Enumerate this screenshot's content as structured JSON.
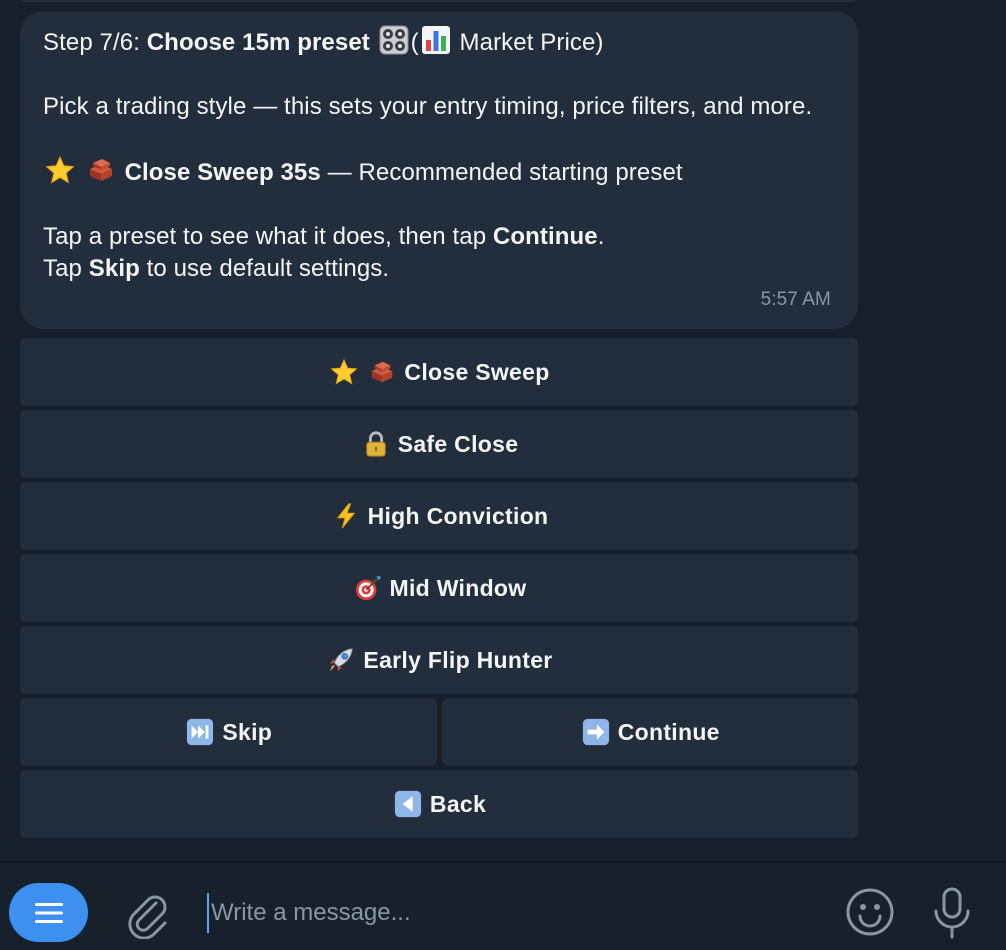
{
  "message": {
    "step_prefix": "Step 7/6: ",
    "title": "Choose 15m preset",
    "paren_open": "(",
    "market_label": "Market Price)",
    "intro": "Pick a trading style — this sets your entry timing, price filters, and more.",
    "recommended_name": "Close Sweep 35s",
    "recommended_suffix": " — Recommended starting preset",
    "tap_line_prefix": "Tap a preset to see what it does, then tap ",
    "tap_line_bold": "Continue",
    "tap_line_suffix": ".",
    "skip_line_prefix": "Tap ",
    "skip_line_bold": "Skip",
    "skip_line_suffix": " to use default settings.",
    "time": "5:57 AM"
  },
  "keyboard": {
    "close_sweep": "Close Sweep",
    "safe_close": "Safe Close",
    "high_conviction": "High Conviction",
    "mid_window": "Mid Window",
    "early_flip_hunter": "Early Flip Hunter",
    "skip": "Skip",
    "continue": "Continue",
    "back": "Back"
  },
  "composer": {
    "placeholder": "Write a message..."
  },
  "icons": {
    "preset": "control-knobs-icon",
    "market": "bar-chart-icon",
    "star": "star-icon",
    "broom": "bricks-icon",
    "lock": "lock-icon",
    "bolt": "lightning-icon",
    "target": "target-icon",
    "rocket": "rocket-icon",
    "skip": "fast-forward-icon",
    "continue": "right-arrow-icon",
    "back": "back-arrow-icon"
  },
  "colors": {
    "background": "#171f2a",
    "bubble": "#232e3c",
    "accent": "#3d8ff0",
    "muted_text": "#8b97a6"
  }
}
